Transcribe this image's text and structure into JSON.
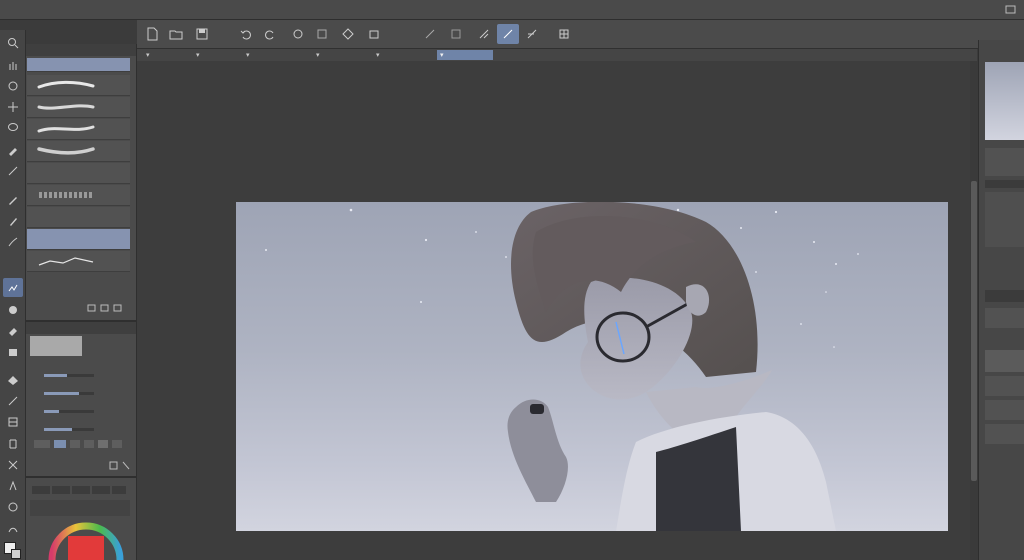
{
  "app": {
    "title": ""
  },
  "menu": {
    "items": [
      "",
      "",
      "",
      "",
      "",
      "",
      "",
      "",
      "",
      "",
      "",
      ""
    ]
  },
  "subtool": {
    "header": "",
    "brushes": [
      {
        "label": ""
      },
      {
        "label": ""
      },
      {
        "label": ""
      },
      {
        "label": ""
      },
      {
        "label": ""
      },
      {
        "label": ""
      },
      {
        "label": ""
      },
      {
        "label": ""
      },
      {
        "label": ""
      }
    ]
  },
  "tool_property": {
    "header": "",
    "rows": [
      {
        "label": "",
        "value": "",
        "level": 0.45
      },
      {
        "label": "",
        "value": "",
        "level": 0.7
      },
      {
        "label": "",
        "value": "",
        "level": 0.3
      },
      {
        "label": "",
        "value": "",
        "level": 0.55
      }
    ]
  },
  "colors": {
    "accent": "#6f84a8",
    "panel_bg": "#4b4b4b",
    "canvas_top": "#9ea4b5",
    "canvas_bottom": "#d2d4df"
  },
  "icons": {
    "toolbar": [
      "zoom-icon",
      "hand-icon",
      "rotate-icon",
      "move-icon",
      "lasso-icon",
      "eyedropper-icon",
      "line-icon",
      "pen-icon",
      "pencil-icon",
      "brush-icon",
      "airbrush-icon",
      "blend-icon",
      "eraser-icon",
      "fill-icon",
      "gradient-icon",
      "figure-icon",
      "frame-icon",
      "ruler-icon",
      "text-icon",
      "balloon-icon",
      "correction-icon"
    ]
  }
}
